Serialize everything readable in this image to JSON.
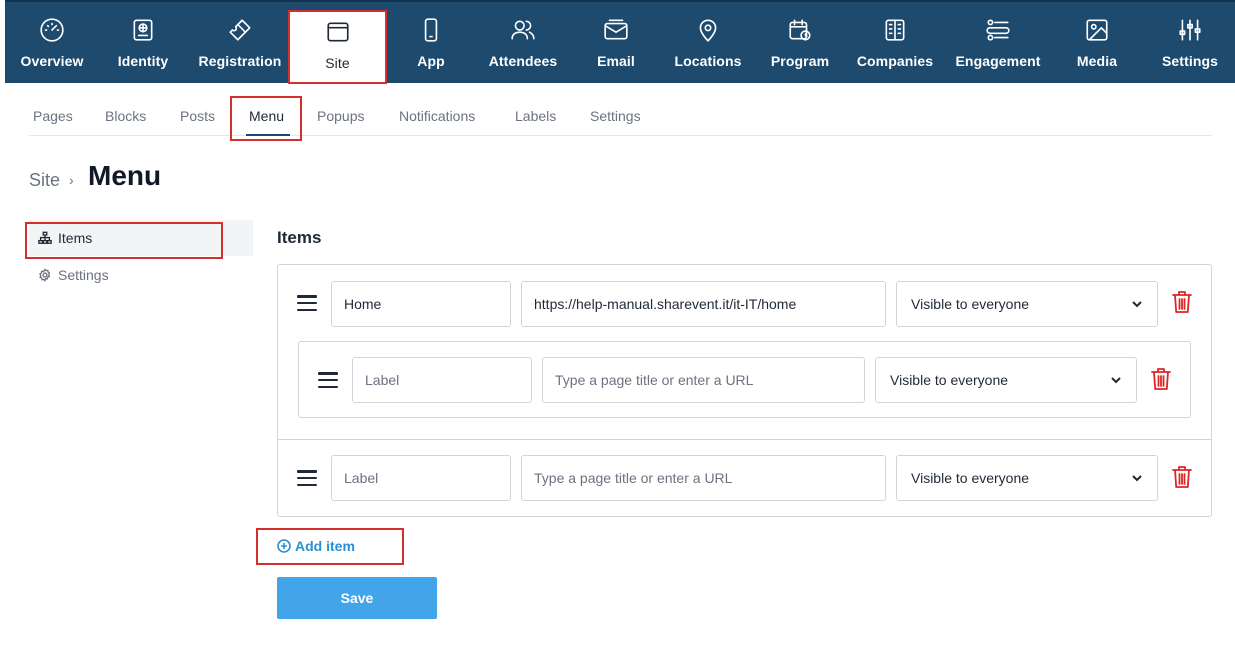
{
  "topnav": {
    "items": [
      {
        "label": "Overview",
        "icon": "gauge-icon"
      },
      {
        "label": "Identity",
        "icon": "id-card-icon"
      },
      {
        "label": "Registration",
        "icon": "ticket-icon"
      },
      {
        "label": "Site",
        "icon": "browser-window-icon",
        "active": true
      },
      {
        "label": "App",
        "icon": "smartphone-icon"
      },
      {
        "label": "Attendees",
        "icon": "users-icon"
      },
      {
        "label": "Email",
        "icon": "mail-icon"
      },
      {
        "label": "Locations",
        "icon": "map-pin-icon"
      },
      {
        "label": "Program",
        "icon": "calendar-clock-icon"
      },
      {
        "label": "Companies",
        "icon": "building-icon"
      },
      {
        "label": "Engagement",
        "icon": "list-users-icon"
      },
      {
        "label": "Media",
        "icon": "image-icon"
      },
      {
        "label": "Settings",
        "icon": "sliders-icon"
      }
    ]
  },
  "subtabs": {
    "items": [
      {
        "label": "Pages"
      },
      {
        "label": "Blocks"
      },
      {
        "label": "Posts"
      },
      {
        "label": "Menu",
        "active": true
      },
      {
        "label": "Popups"
      },
      {
        "label": "Notifications"
      },
      {
        "label": "Labels"
      },
      {
        "label": "Settings"
      }
    ]
  },
  "breadcrumb": {
    "parent": "Site",
    "separator": "›",
    "title": "Menu"
  },
  "sidebar": {
    "items": [
      {
        "label": "Items",
        "icon": "sitemap-icon",
        "active": true
      },
      {
        "label": "Settings",
        "icon": "gear-icon"
      }
    ]
  },
  "items_section": {
    "heading": "Items",
    "rows": [
      {
        "label_value": "Home",
        "label_placeholder": "Label",
        "url_value": "https://help-manual.sharevent.it/it-IT/home",
        "url_placeholder": "Type a page title or enter a URL",
        "visibility": "Visible to everyone"
      },
      {
        "label_value": "",
        "label_placeholder": "Label",
        "url_value": "",
        "url_placeholder": "Type a page title or enter a URL",
        "visibility": "Visible to everyone"
      },
      {
        "label_value": "",
        "label_placeholder": "Label",
        "url_value": "",
        "url_placeholder": "Type a page title or enter a URL",
        "visibility": "Visible to everyone"
      }
    ],
    "add_item_label": "Add item",
    "save_label": "Save"
  },
  "colors": {
    "nav_background": "#1e4a6e",
    "highlight_border": "#d32f2f",
    "delete_red": "#dc2626",
    "link_blue": "#2b8fd6",
    "save_button": "#42a5ea"
  }
}
